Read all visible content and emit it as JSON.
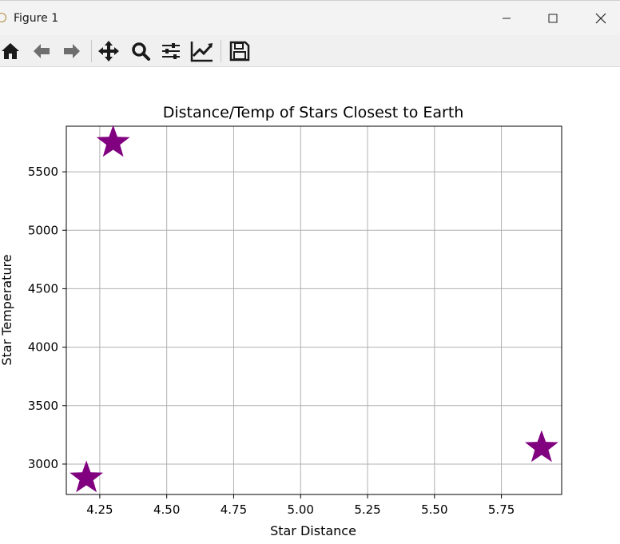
{
  "window": {
    "title": "Figure 1",
    "icon": "matplotlib-icon",
    "controls": [
      "minimize-icon",
      "maximize-icon",
      "close-icon"
    ]
  },
  "toolbar": {
    "tools": [
      "home-icon",
      "back-arrow-icon",
      "forward-arrow-icon",
      "pan-icon",
      "zoom-icon",
      "configure-subplots-icon",
      "edit-axis-icon",
      "save-icon"
    ]
  },
  "colors": {
    "marker": "#800080",
    "grid": "#b0b0b0"
  },
  "chart_data": {
    "type": "scatter",
    "title": "Distance/Temp of Stars Closest to Earth",
    "xlabel": "Star Distance",
    "ylabel": "Star Temperature",
    "xlim": [
      4.125,
      5.975
    ],
    "ylim": [
      2740,
      5890
    ],
    "xticks": [
      4.25,
      4.5,
      4.75,
      5.0,
      5.25,
      5.5,
      5.75
    ],
    "xtick_labels": [
      "4.25",
      "4.50",
      "4.75",
      "5.00",
      "5.25",
      "5.50",
      "5.75"
    ],
    "yticks": [
      3000,
      3500,
      4000,
      4500,
      5000,
      5500
    ],
    "ytick_labels": [
      "3000",
      "3500",
      "4000",
      "4500",
      "5000",
      "5500"
    ],
    "grid": true,
    "marker": "star",
    "points": [
      {
        "x": 4.2,
        "y": 2880
      },
      {
        "x": 4.3,
        "y": 5750
      },
      {
        "x": 5.9,
        "y": 3140
      }
    ]
  }
}
